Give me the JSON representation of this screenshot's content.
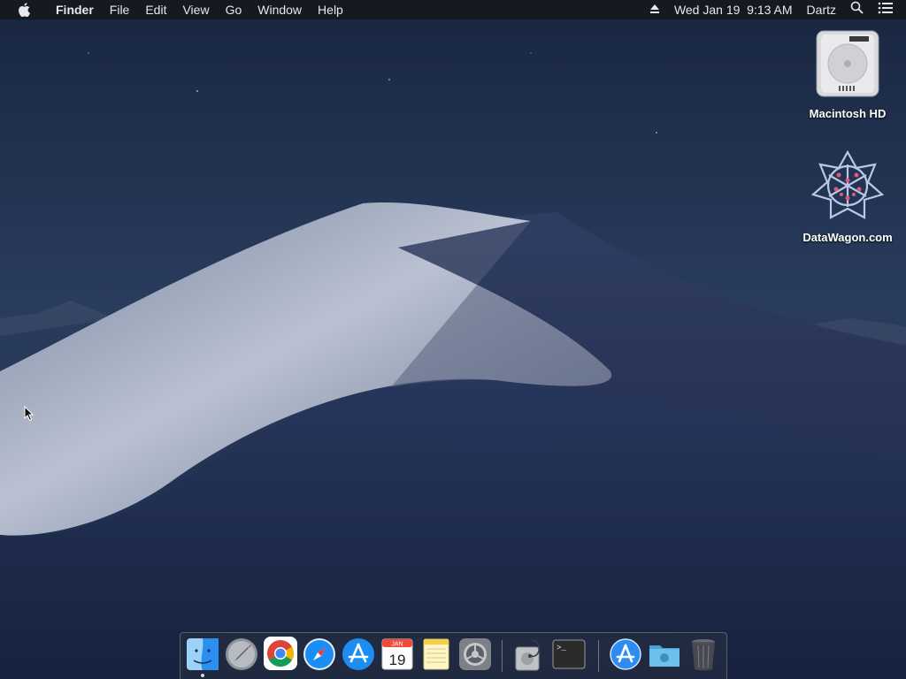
{
  "menubar": {
    "app_name": "Finder",
    "menus": [
      "File",
      "Edit",
      "View",
      "Go",
      "Window",
      "Help"
    ],
    "status": {
      "eject_icon": "eject-icon",
      "datetime": "Wed Jan 19  9:13 AM",
      "user": "Dartz",
      "spotlight_icon": "search-icon",
      "notification_icon": "notification-center-icon"
    }
  },
  "desktop": {
    "icons": [
      {
        "label": "Macintosh HD",
        "icon": "hard-drive-icon"
      },
      {
        "label": "DataWagon.com",
        "icon": "datawagon-icon"
      }
    ]
  },
  "dock": {
    "apps": [
      {
        "name": "Finder",
        "icon": "finder-icon",
        "running": true
      },
      {
        "name": "Launchpad",
        "icon": "launchpad-icon"
      },
      {
        "name": "Google Chrome",
        "icon": "chrome-icon"
      },
      {
        "name": "Safari",
        "icon": "safari-icon"
      },
      {
        "name": "App Store",
        "icon": "app-store-icon"
      },
      {
        "name": "Calendar",
        "icon": "calendar-icon",
        "month": "JAN",
        "day": "19"
      },
      {
        "name": "Notes",
        "icon": "notes-icon"
      },
      {
        "name": "System Preferences",
        "icon": "system-preferences-icon"
      },
      {
        "name": "Disk Utility",
        "icon": "disk-utility-icon"
      },
      {
        "name": "Terminal",
        "icon": "terminal-icon",
        "prompt": ">_"
      },
      {
        "name": "Applications",
        "icon": "applications-folder-icon"
      },
      {
        "name": "Downloads",
        "icon": "downloads-folder-icon"
      },
      {
        "name": "Trash",
        "icon": "trash-icon"
      }
    ]
  },
  "colors": {
    "menubar_bg": "#16181e",
    "sky": "#1f3050",
    "dune_light": "#a9b3c8"
  }
}
